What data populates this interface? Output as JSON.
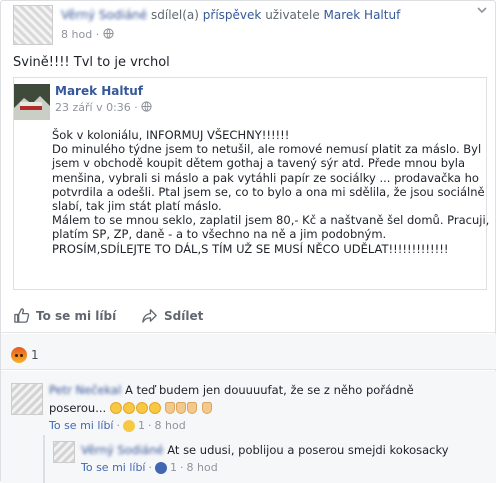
{
  "post": {
    "author_blurred": "Věrný Sodiáné",
    "shared_verb": "sdílel(a)",
    "shared_object": "příspěvek",
    "of_user": "uživatele",
    "original_author": "Marek Haltuf",
    "time": "8 hod",
    "text": "Svině!!!! Tvl to je vrchol"
  },
  "shared_post": {
    "author": "Marek Haltuf",
    "time": "23 září v 0:36",
    "lines": [
      "Šok v koloniálu, INFORMUJ VŠECHNY!!!!!!",
      "Do minulého týdne jsem to netušil, ale romové nemusí platit za máslo. Byl",
      "jsem v obchodě koupit dětem gothaj a tavený sýr atd. Přede mnou byla",
      "menšina, vybrali si máslo a pak vytáhli papír ze sociálky ... prodavačka ho",
      "potvrdila a odešli. Ptal jsem se, co to bylo a ona mi sdělila, že jsou sociálně",
      "slabí, tak jim stát platí máslo.",
      "Málem to se mnou seklo, zaplatil jsem 80,- Kč a naštvaně šel domů. Pracuji,",
      "platím SP, ZP, daně - a to všechno na ně a jim podobným.",
      "PROSÍM,SDÍLEJTE TO DÁL,S TÍM UŽ SE MUSÍ NĚCO UDĚLAT!!!!!!!!!!!!!"
    ]
  },
  "actions": {
    "like_label": "To se mi líbí",
    "share_label": "Sdílet"
  },
  "reactions": {
    "count": "1"
  },
  "comments": [
    {
      "author_blurred": "Petr Nečekal",
      "text_line1": "A teď budem jen douuuufat, že se z něho pořádně",
      "text_line2": "poserou...",
      "like_label": "To se mi líbí",
      "reaction_count": "1",
      "time": "8 hod"
    },
    {
      "author_blurred": "Věrný Sodiáné",
      "text": "At se udusi, poblijou a poserou smejdi kokosacky",
      "like_label": "To se mi líbí",
      "reaction_count": "1",
      "time": "8 hod"
    }
  ],
  "colors": {
    "link": "#365899",
    "meta": "#90949c",
    "like_blue": "#4267b2"
  }
}
